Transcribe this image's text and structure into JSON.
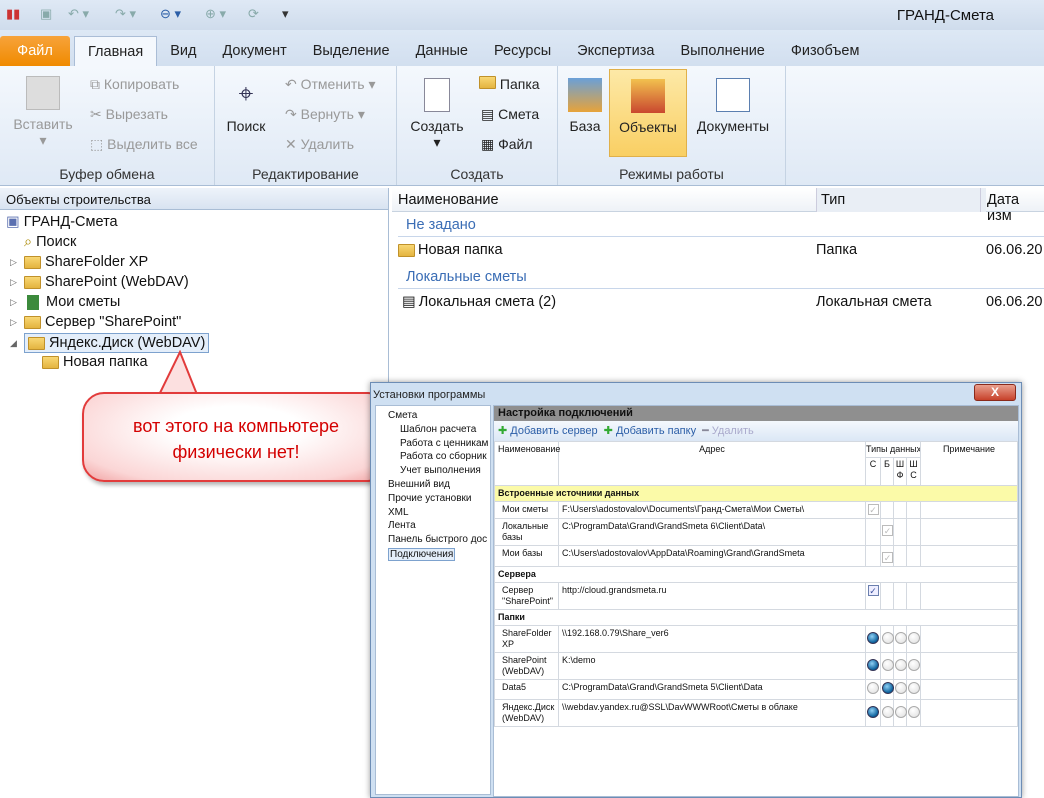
{
  "app": {
    "title": "ГРАНД-Смета"
  },
  "tabs": [
    {
      "label": "Файл"
    },
    {
      "label": "Главная"
    },
    {
      "label": "Вид"
    },
    {
      "label": "Документ"
    },
    {
      "label": "Выделение"
    },
    {
      "label": "Данные"
    },
    {
      "label": "Ресурсы"
    },
    {
      "label": "Экспертиза"
    },
    {
      "label": "Выполнение"
    },
    {
      "label": "Физобъем"
    }
  ],
  "ribbon": {
    "clipboard": {
      "label": "Буфер обмена",
      "paste": "Вставить",
      "copy": "Копировать",
      "cut": "Вырезать",
      "select_all": "Выделить все"
    },
    "editing": {
      "label": "Редактирование",
      "search": "Поиск",
      "undo": "Отменить",
      "redo": "Вернуть",
      "delete": "Удалить"
    },
    "create": {
      "label": "Создать",
      "create": "Создать",
      "folder": "Папка",
      "estimate": "Смета",
      "file": "Файл"
    },
    "modes": {
      "label": "Режимы работы",
      "base": "База",
      "objects": "Объекты",
      "documents": "Документы"
    }
  },
  "left": {
    "header": "Объекты строительства",
    "tree": [
      {
        "label": "ГРАНД-Смета",
        "icon": "root-icon"
      },
      {
        "label": "Поиск",
        "icon": "search-icon"
      },
      {
        "label": "ShareFolder XP",
        "icon": "folder-icon"
      },
      {
        "label": "SharePoint (WebDAV)",
        "icon": "folder-icon"
      },
      {
        "label": "Мои сметы",
        "icon": "book-icon"
      },
      {
        "label": "Сервер \"SharePoint\"",
        "icon": "folder-icon"
      },
      {
        "label": "Яндекс.Диск (WebDAV)",
        "icon": "folder-icon"
      },
      {
        "label": "Новая папка",
        "icon": "folder-icon"
      }
    ]
  },
  "list": {
    "columns": [
      "Наименование",
      "Тип",
      "Дата изм"
    ],
    "groups": [
      {
        "title": "Не задано",
        "rows": [
          {
            "name": "Новая папка",
            "type": "Папка",
            "date": "06.06.20"
          }
        ]
      },
      {
        "title": "Локальные сметы",
        "rows": [
          {
            "name": "Локальная смета (2)",
            "type": "Локальная смета",
            "date": "06.06.20"
          }
        ]
      }
    ]
  },
  "callout": {
    "line1": "вот этого на компьютере",
    "line2": "физически нет!"
  },
  "dialog": {
    "title": "Установки программы",
    "close": "X",
    "tree": [
      "Смета",
      "Шаблон расчета",
      "Работа с ценникам",
      "Работа со сборник",
      "Учет выполнения",
      "Внешний вид",
      "Прочие установки",
      "XML",
      "Лента",
      "Панель быстрого дос",
      "Подключения"
    ],
    "panel_title": "Настройка подключений",
    "toolbar": {
      "add_server": "Добавить сервер",
      "add_folder": "Добавить папку",
      "delete": "Удалить"
    },
    "columns": {
      "name": "Наименование",
      "address": "Адрес",
      "types": "Типы данных",
      "note": "Примечание",
      "c": "С",
      "b": "Б",
      "shf": "Ш Ф",
      "shs": "Ш С"
    },
    "groups": [
      {
        "title": "Встроенные источники данных",
        "kind": "check",
        "rows": [
          {
            "name": "Мои сметы",
            "address": "F:\\Users\\adostovalov\\Documents\\Гранд-Смета\\Мои Сметы\\",
            "col": 0,
            "enabled": false
          },
          {
            "name": "Локальные базы",
            "address": "C:\\ProgramData\\Grand\\GrandSmeta 6\\Client\\Data\\",
            "col": 1,
            "enabled": false
          },
          {
            "name": "Мои базы",
            "address": "C:\\Users\\adostovalov\\AppData\\Roaming\\Grand\\GrandSmeta",
            "col": 1,
            "enabled": false
          }
        ]
      },
      {
        "title": "Сервера",
        "kind": "check",
        "rows": [
          {
            "name": "Сервер \"SharePoint\"",
            "address": "http://cloud.grandsmeta.ru",
            "col": 0,
            "enabled": true
          }
        ]
      },
      {
        "title": "Папки",
        "kind": "radio",
        "rows": [
          {
            "name": "ShareFolder XP",
            "address": "\\\\192.168.0.79\\Share_ver6",
            "col": 0
          },
          {
            "name": "SharePoint (WebDAV)",
            "address": "K:\\demo",
            "col": 0
          },
          {
            "name": "Data5",
            "address": "C:\\ProgramData\\Grand\\GrandSmeta 5\\Client\\Data",
            "col": 1
          },
          {
            "name": "Яндекс.Диск (WebDAV)",
            "address": "\\\\webdav.yandex.ru@SSL\\DavWWWRoot\\Сметы в облаке",
            "col": 0
          }
        ]
      }
    ]
  }
}
